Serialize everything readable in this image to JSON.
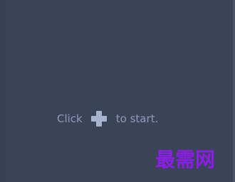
{
  "empty_state": {
    "before_text": "Click",
    "after_text": "to start.",
    "icon": "plus-icon"
  },
  "watermark": {
    "text": "最需网",
    "color": "#8c1ce8"
  },
  "colors": {
    "background": "#3a4457",
    "text": "#8f9ab8",
    "icon": "#a8b3cf"
  }
}
